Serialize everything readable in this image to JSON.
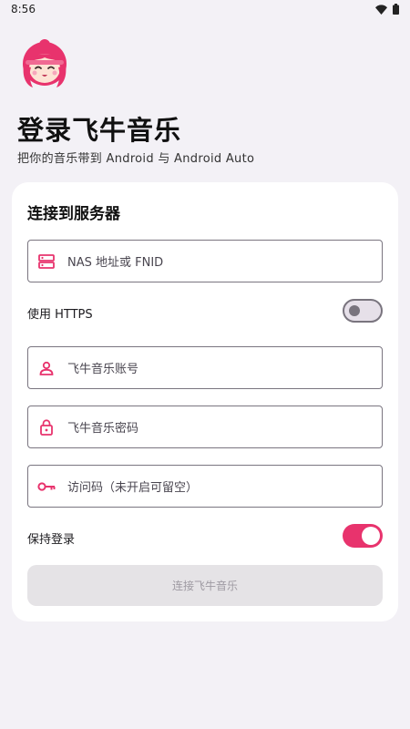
{
  "status_bar": {
    "time": "8:56",
    "icons": [
      "wifi-icon",
      "battery-icon"
    ]
  },
  "header": {
    "title": "登录飞牛音乐",
    "subtitle": "把你的音乐带到 Android 与 Android Auto"
  },
  "card": {
    "title": "连接到服务器",
    "server_field": {
      "placeholder": "NAS 地址或 FNID",
      "icon": "server-icon"
    },
    "https_label": "使用 HTTPS",
    "https_enabled": false,
    "username_field": {
      "placeholder": "飞牛音乐账号",
      "icon": "person-icon"
    },
    "password_field": {
      "placeholder": "飞牛音乐密码",
      "icon": "lock-icon"
    },
    "access_code_field": {
      "placeholder": "访问码（未开启可留空）",
      "icon": "key-icon"
    },
    "keep_login_label": "保持登录",
    "keep_login_enabled": true,
    "connect_button": "连接飞牛音乐"
  },
  "colors": {
    "accent": "#e8336d",
    "background": "#f3f1f6",
    "card": "#ffffff"
  }
}
